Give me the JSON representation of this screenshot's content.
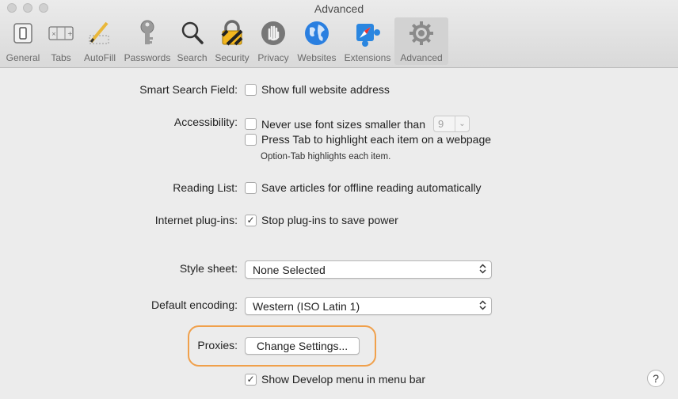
{
  "window": {
    "title": "Advanced"
  },
  "toolbar": {
    "items": [
      {
        "label": "General",
        "icon": "switch-icon"
      },
      {
        "label": "Tabs",
        "icon": "tabs-icon"
      },
      {
        "label": "AutoFill",
        "icon": "pencil-icon"
      },
      {
        "label": "Passwords",
        "icon": "key-icon"
      },
      {
        "label": "Search",
        "icon": "magnifier-icon"
      },
      {
        "label": "Security",
        "icon": "padlock-icon"
      },
      {
        "label": "Privacy",
        "icon": "hand-icon"
      },
      {
        "label": "Websites",
        "icon": "globe-icon"
      },
      {
        "label": "Extensions",
        "icon": "puzzle-compass-icon"
      },
      {
        "label": "Advanced",
        "icon": "gear-icon"
      }
    ],
    "selected": "Advanced"
  },
  "settings": {
    "smart_search": {
      "label": "Smart Search Field:",
      "option": "Show full website address",
      "checked": false
    },
    "accessibility": {
      "label": "Accessibility:",
      "option1": "Never use font sizes smaller than",
      "font_size_value": "9",
      "option2": "Press Tab to highlight each item on a webpage",
      "note": "Option-Tab highlights each item."
    },
    "reading_list": {
      "label": "Reading List:",
      "option": "Save articles for offline reading automatically"
    },
    "plugins": {
      "label": "Internet plug-ins:",
      "option": "Stop plug-ins to save power",
      "checked": true
    },
    "style_sheet": {
      "label": "Style sheet:",
      "value": "None Selected"
    },
    "encoding": {
      "label": "Default encoding:",
      "value": "Western (ISO Latin 1)"
    },
    "proxies": {
      "label": "Proxies:",
      "button": "Change Settings..."
    },
    "develop": {
      "option": "Show Develop menu in menu bar",
      "checked": true
    }
  },
  "glyphs": {
    "check": "✓",
    "chevron_updown": "⌃⌄",
    "chevron_down": "⌄",
    "help": "?"
  },
  "colors": {
    "highlight_ring": "#f0a04b"
  }
}
